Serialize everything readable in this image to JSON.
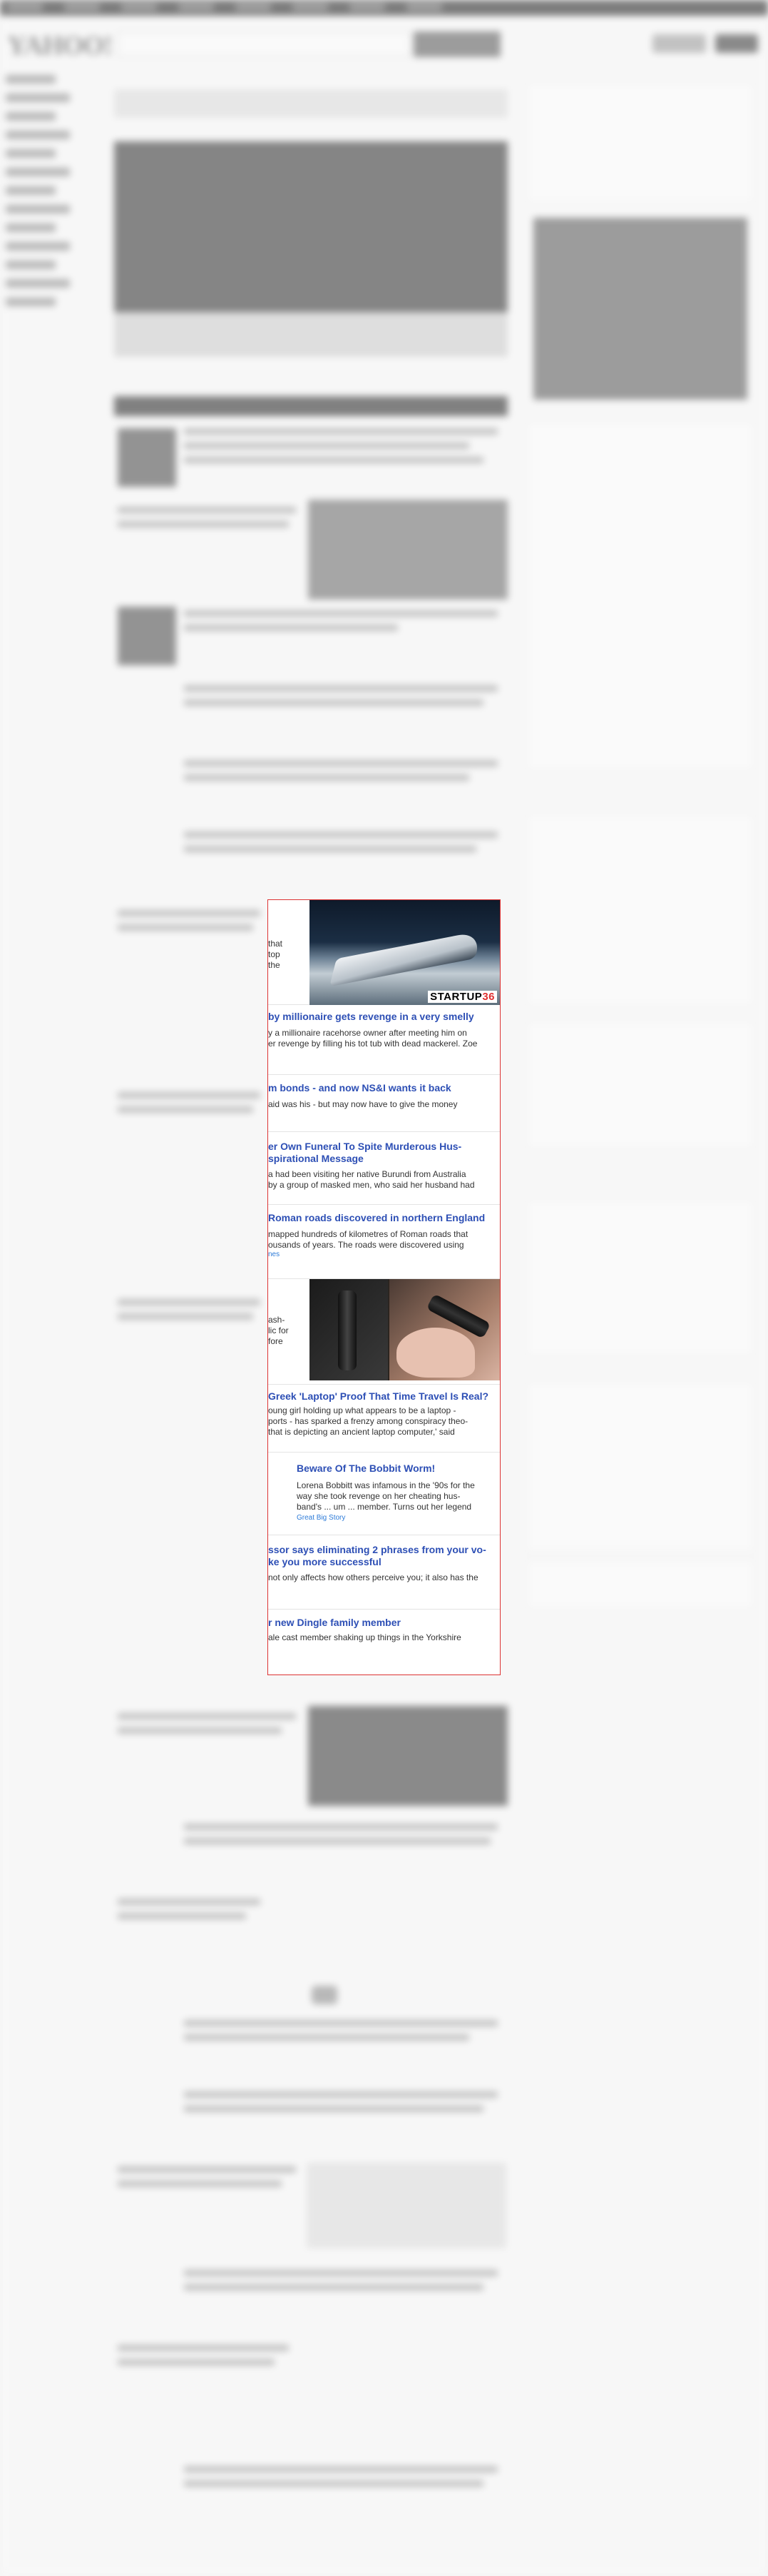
{
  "ads": [
    {
      "title": "",
      "desc": "that\ntop\nthe",
      "image_label": "STARTUP",
      "image_label_num": "36"
    },
    {
      "title": "by millionaire gets revenge in a very smelly",
      "desc": "y a millionaire racehorse owner after meeting him on\ner revenge by filling his tot tub with dead mackerel. Zoe"
    },
    {
      "title": "m bonds - and now NS&I wants it back",
      "desc": "aid was his - but may now have to give the money"
    },
    {
      "title": "er Own Funeral To Spite Murderous Hus-\nspirational Message",
      "desc": "a had been visiting her native Burundi from Australia\nby a group of masked men, who said her husband had"
    },
    {
      "title": "Roman roads discovered in northern England",
      "desc": "mapped hundreds of kilometres of Roman roads that\nousands of years. The roads were discovered using",
      "src": "nes"
    },
    {
      "title": "",
      "desc": "ash-\nlic for\nfore"
    },
    {
      "title": "Greek 'Laptop' Proof That Time Travel Is Real?",
      "desc": "oung girl holding up what appears to be a laptop -\nports - has sparked a frenzy among conspiracy theo-\nthat is depicting an ancient laptop computer,' said"
    },
    {
      "title": "Beware Of The Bobbit Worm!",
      "desc": "Lorena Bobbitt was infamous in the '90s for the\nway she took revenge on her cheating hus-\nband's ... um ... member. Turns out her legend",
      "src": "Great Big Story"
    },
    {
      "title": "ssor says eliminating 2 phrases from your vo-\nke you more successful",
      "desc": "not only affects how others perceive you; it also has the"
    },
    {
      "title": "r new Dingle family member",
      "desc": "ale cast member shaking up things in the Yorkshire"
    }
  ]
}
